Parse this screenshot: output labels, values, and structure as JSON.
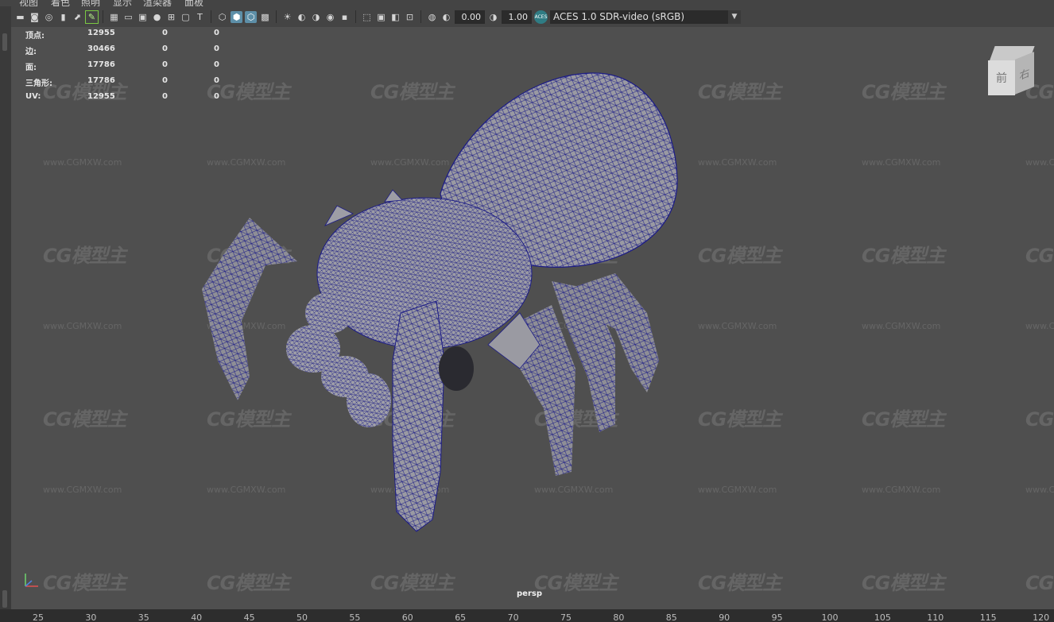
{
  "menu": [
    "视图",
    "着色",
    "照明",
    "显示",
    "渲染器",
    "面板"
  ],
  "toolbar": {
    "icons": [
      "camera-select-icon",
      "camera-attributes-icon",
      "bookmark-icon",
      "image-plane-icon",
      "2d-pan-zoom-icon",
      "grease-pencil-icon",
      "grid-icon",
      "film-gate-icon",
      "resolution-gate-icon",
      "gate-mask-icon",
      "field-chart-icon",
      "safe-action-icon",
      "safe-title-icon",
      "wireframe-icon",
      "smooth-shade-icon",
      "wireframe-on-shaded-icon",
      "textured-icon",
      "use-all-lights-icon",
      "shadows-icon",
      "screen-space-ao-icon",
      "motion-blur-icon",
      "anti-aliasing-icon",
      "isolate-select-icon",
      "xray-icon",
      "xray-joints-icon",
      "backface-culling-icon",
      "exposure-icon",
      "gamma-icon"
    ],
    "exposure_value": "0.00",
    "gamma_value": "1.00",
    "colorspace": "ACES 1.0 SDR-video (sRGB)",
    "aces_badge": "ACES"
  },
  "hud": [
    {
      "label": "顶点:",
      "v1": "12955",
      "v2": "0",
      "v3": "0"
    },
    {
      "label": "边:",
      "v1": "30466",
      "v2": "0",
      "v3": "0"
    },
    {
      "label": "面:",
      "v1": "17786",
      "v2": "0",
      "v3": "0"
    },
    {
      "label": "三角形:",
      "v1": "17786",
      "v2": "0",
      "v3": "0"
    },
    {
      "label": "UV:",
      "v1": "12955",
      "v2": "0",
      "v3": "0"
    }
  ],
  "viewcube": {
    "front": "前",
    "right": "右"
  },
  "watermark": {
    "logo": "CG模型主",
    "url": "www.CGMXW.com"
  },
  "camera_label": "persp",
  "colors": {
    "wire": "#1c1c86",
    "mesh": "#9a9aa2",
    "viewport_bg": "#4f4f4f"
  },
  "timeline_ticks": [
    "25",
    "30",
    "35",
    "40",
    "45",
    "50",
    "55",
    "60",
    "65",
    "70",
    "75",
    "80",
    "85",
    "90",
    "95",
    "100",
    "105",
    "110",
    "115",
    "120"
  ]
}
